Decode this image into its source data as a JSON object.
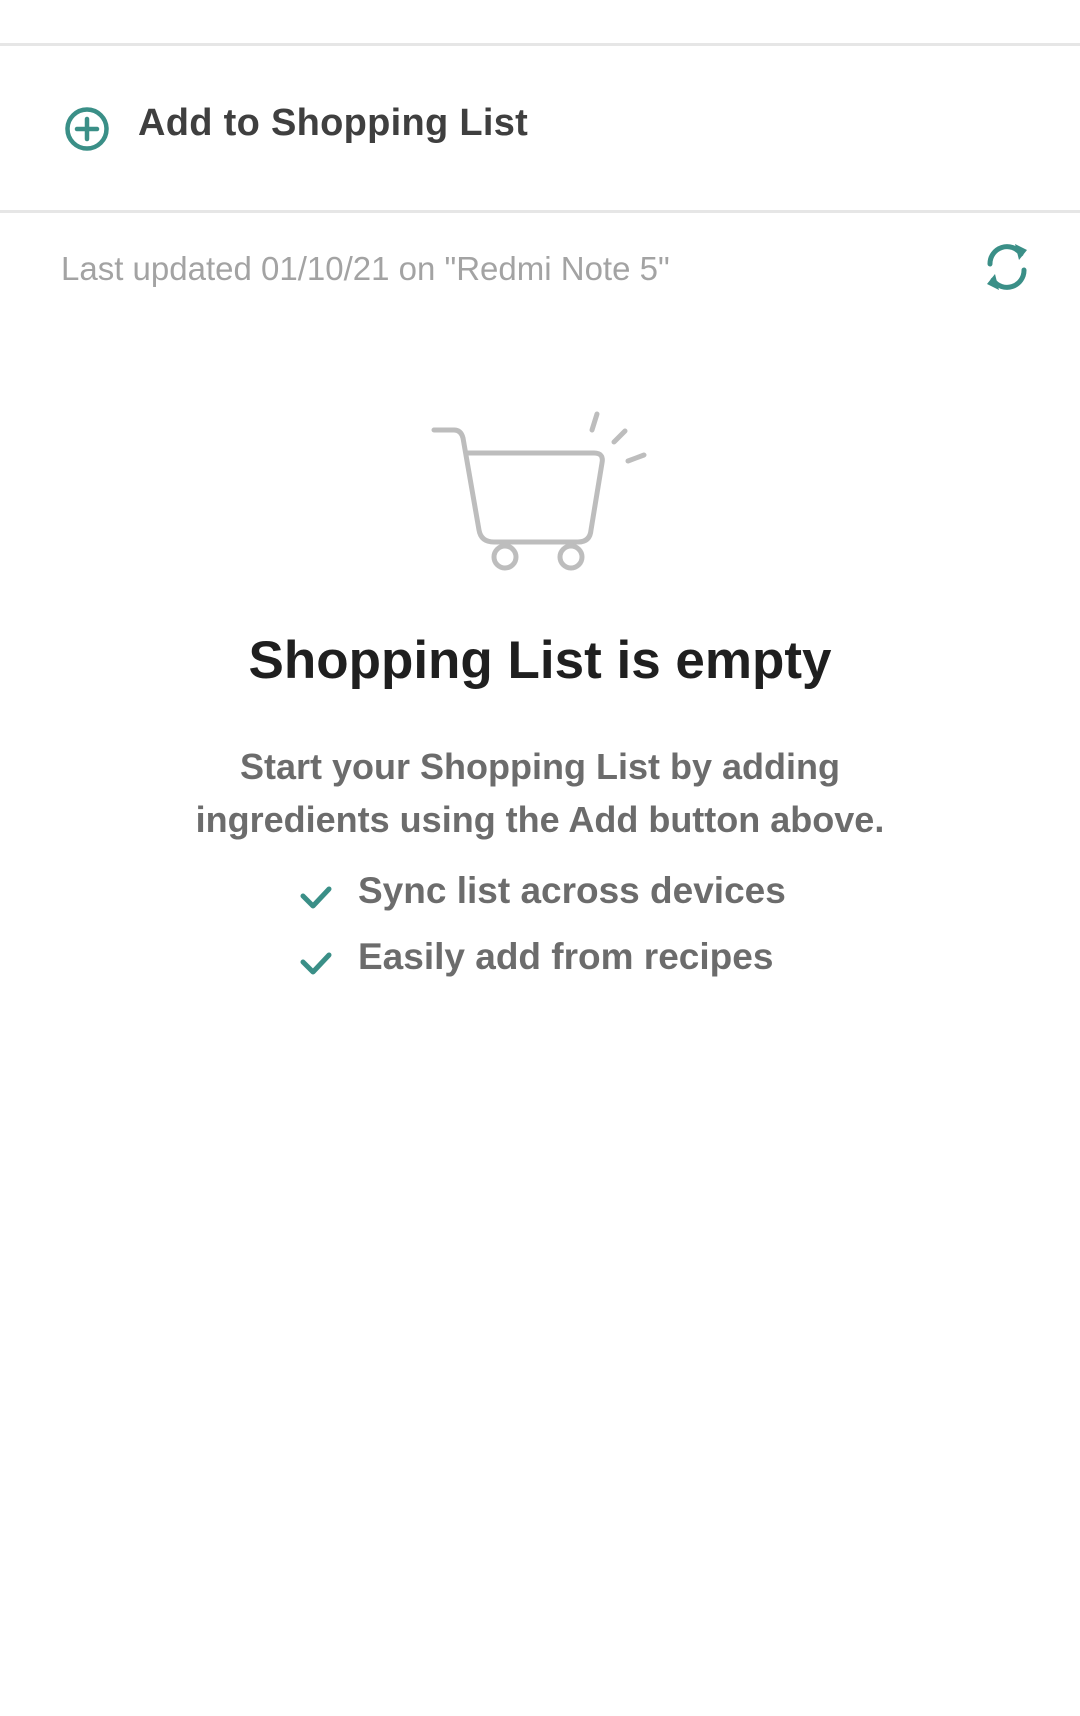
{
  "actions": {
    "add_label": "Add to Shopping List"
  },
  "status": {
    "last_updated": "Last updated 01/10/21 on \"Redmi Note 5\""
  },
  "empty_state": {
    "title": "Shopping List is empty",
    "description_line1": "Start your Shopping List by adding",
    "description_line2": "ingredients using the Add button above.",
    "features": [
      {
        "label": "Sync list across devices"
      },
      {
        "label": "Easily add from recipes"
      }
    ]
  },
  "icons": {
    "add": "plus-circle-icon",
    "sync": "refresh-icon",
    "check": "check-icon",
    "illustration": "shopping-cart-icon"
  },
  "colors": {
    "accent": "#3a8f87",
    "divider": "#e6e6e6",
    "title": "#1f1f1f",
    "body": "#6c6c6c",
    "muted": "#a3a3a3",
    "illustration": "#bdbdbd"
  }
}
